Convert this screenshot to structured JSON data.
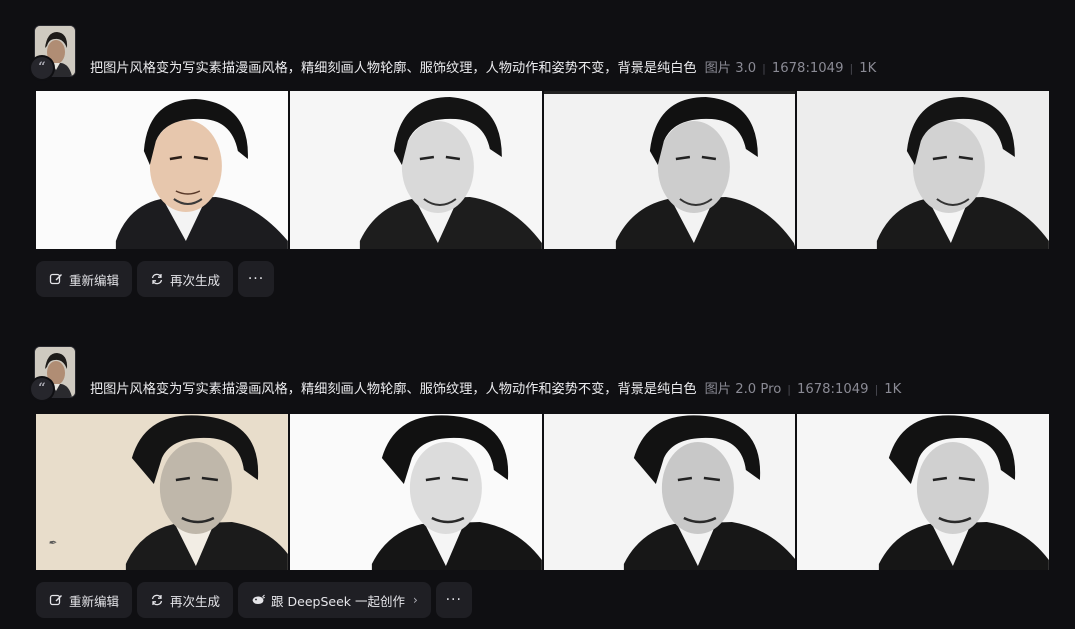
{
  "generations": [
    {
      "prompt": "把图片风格变为写实素描漫画风格，精细刻画人物轮廓、服饰纹理，人物动作和姿势不变，背景是纯白色",
      "model": "图片 3.0",
      "ratio": "1678:1049",
      "resolution": "1K",
      "actions": {
        "edit": "重新编辑",
        "regenerate": "再次生成",
        "more": "···"
      }
    },
    {
      "prompt": "把图片风格变为写实素描漫画风格，精细刻画人物轮廓、服饰纹理，人物动作和姿势不变，背景是纯白色",
      "model": "图片 2.0 Pro",
      "ratio": "1678:1049",
      "resolution": "1K",
      "actions": {
        "edit": "重新编辑",
        "regenerate": "再次生成",
        "deepseek": "跟 DeepSeek 一起创作",
        "more": "···"
      }
    }
  ],
  "icons": {
    "quote": "quote-icon",
    "edit": "edit-icon",
    "regenerate": "refresh-icon",
    "deepseek": "whale-icon",
    "chevron": "chevron-right-icon",
    "more": "more-icon"
  }
}
